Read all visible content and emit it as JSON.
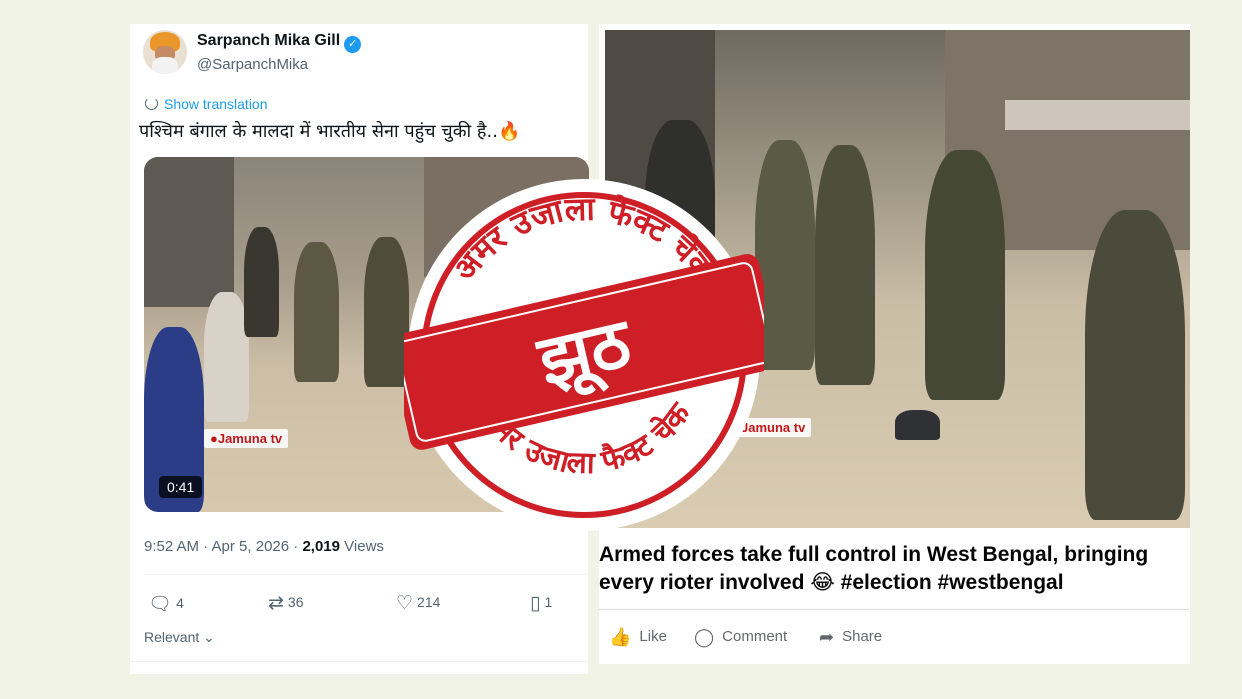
{
  "tweet": {
    "author_name": "Sarpanch Mika Gill",
    "verified_mark": "✓",
    "handle": "@SarpanchMika",
    "show_translation": "Show translation",
    "text": "पश्चिम बंगाल के मालदा में भारतीय सेना पहुंच चुकी है..",
    "emoji": "🔥",
    "video_duration": "0:41",
    "channel_watermark": "●Jamuna tv",
    "time_date": "9:52 AM · Apr 5, 2026 · ",
    "views_count": "2,019",
    "views_label": "Views",
    "replies": "4",
    "reposts": "36",
    "likes": "214",
    "bookmarks": "1",
    "sort_label": "Relevant",
    "icons": [
      "reply-icon",
      "repost-icon",
      "like-icon",
      "bookmark-icon",
      "verified-badge-icon",
      "translate-icon"
    ]
  },
  "facebook_post": {
    "channel_watermark": "Jamuna tv",
    "caption_line1": "Armed forces take full control in West Bengal, bringing",
    "caption_line2": "every rioter involved 😂 #election #westbengal",
    "like_label": "Like",
    "comment_label": "Comment",
    "share_label": "Share"
  },
  "stamp": {
    "verdict": "झूठ",
    "ring_text": "अमर उजाला फैक्ट चेक",
    "color": "#cf1f26"
  },
  "colors": {
    "background": "#f1f3e6",
    "twitter_blue": "#1d9bf0",
    "stamp_red": "#cf1f26"
  }
}
